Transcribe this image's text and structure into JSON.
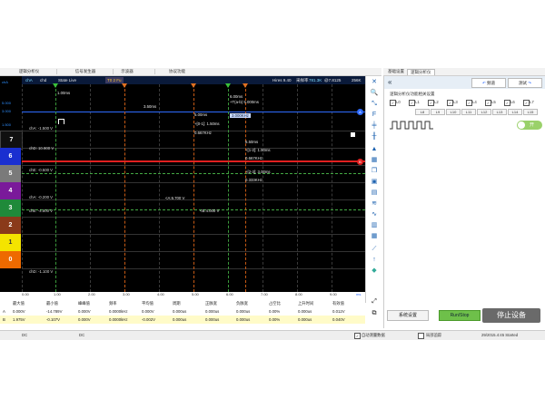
{
  "top_tabs": [
    "逻辑分析仪",
    "信号发生器",
    "示波器",
    "协议功能"
  ],
  "right_tabs": [
    "基础设置",
    "逻辑分析仪"
  ],
  "status": {
    "ch": "chA",
    "chd": "chd",
    "trig": "State Live",
    "pos": "T0 2 Fu",
    "hires": "Hires 9.40",
    "rate_label": "采样率",
    "rate": "781.3K",
    "scale": "@7.8125",
    "mem": "256K"
  },
  "y_labels": [
    {
      "text": "chA",
      "color": "#2e8fff"
    },
    {
      "text": "5.000",
      "color": "#2e8fff"
    },
    {
      "text": "3.000",
      "color": "#2e8fff"
    },
    {
      "text": "1.500",
      "color": "#2e8fff"
    }
  ],
  "channels": [
    {
      "num": "7",
      "color": "#101010"
    },
    {
      "num": "6",
      "color": "#1a2fd0"
    },
    {
      "num": "5",
      "color": "#7a7a7a"
    },
    {
      "num": "4",
      "color": "#7a1a9a"
    },
    {
      "num": "3",
      "color": "#1f8a3a"
    },
    {
      "num": "2",
      "color": "#8a3a1a"
    },
    {
      "num": "1",
      "color": "#f4e400"
    },
    {
      "num": "0",
      "color": "#ee6a00"
    }
  ],
  "trace_labels": [
    "chA: -1.500 V",
    "chD: 10.900 V",
    "chE: -0.500 V",
    "chA: -0.200 V",
    "chE: -4.500 V",
    "chD: -1.100 V"
  ],
  "markers": {
    "m1": "1.00ms",
    "m2": "3.50ms",
    "m3": "5.00ms",
    "m4": "6.00ms",
    "delta": "+T(a-b) 5.000ms",
    "freq_a": "3.000KHz",
    "d1": "+[0-1]: 1.50ms",
    "d1f": "0.667KHz",
    "t3": "6.50ms",
    "d2": "+[1-2]: 1.50ms",
    "d2f": "0.667KHz",
    "d3": "+[2-3]: 3.00ms",
    "d3f": "0.333KHz",
    "v1": "<A:6.700 V",
    "v2": "<B:4.000 V"
  },
  "x_ticks": [
    "0.00",
    "1.00",
    "2.00",
    "3.00",
    "4.00",
    "5.00",
    "6.00",
    "7.00",
    "8.00",
    "9.00",
    "ms"
  ],
  "meas_headers": [
    "最大值",
    "最小值",
    "峰峰值",
    "频率",
    "平均值",
    "周期",
    "正脉宽",
    "负脉宽",
    "占空比",
    "上升时间",
    "有效值"
  ],
  "meas_rows": [
    {
      "ch": "A",
      "values": [
        "0.000V",
        "-14.789V",
        "0.000V",
        "0.0000kHz",
        "0.000V",
        "0.000us",
        "0.000us",
        "0.000us",
        "0.00%",
        "0.000us",
        "0.012V"
      ]
    },
    {
      "ch": "B",
      "values": [
        "1.975V",
        "-0.107V",
        "0.000V",
        "0.0000kHz",
        "-0.002V",
        "0.000us",
        "0.000us",
        "0.000us",
        "0.00%",
        "0.000us",
        "0.040V"
      ]
    }
  ],
  "right_panel": {
    "title": "逻辑分析仪功能相关设置",
    "btn_a": "频道",
    "btn_b": "测试",
    "checks": [
      "L0",
      "L1",
      "L2",
      "L3",
      "L4",
      "L5",
      "L6",
      "L7"
    ],
    "chips": [
      "L8",
      "L9",
      "L10",
      "L11",
      "L12",
      "L13",
      "L14",
      "L15"
    ],
    "toggle": "开",
    "sys_btn": "系统设置",
    "run_btn": "Run/Stop",
    "stop_btn": "停止设备"
  },
  "bottom": {
    "dc1": "DC",
    "dc2": "DC",
    "auto": "自动测量数据",
    "trace": "局部追踪",
    "status": "29/2015.4:45 Started"
  }
}
